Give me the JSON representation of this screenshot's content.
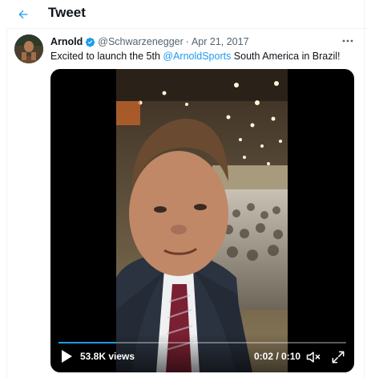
{
  "header": {
    "title": "Tweet",
    "back_icon": "arrow-left-icon"
  },
  "tweet": {
    "author_name": "Arnold",
    "handle": "@Schwarzenegger",
    "separator": "·",
    "date": "Apr 21, 2017",
    "text_before": "Excited to launch the 5th ",
    "mention": "@ArnoldSports",
    "text_after": " South America in Brazil!",
    "verified_icon": "verified-badge-icon",
    "more_icon": "more-horizontal-icon"
  },
  "video": {
    "views": "53.8K views",
    "time": "0:02 / 0:10",
    "progress": 0.2,
    "play_icon": "play-icon",
    "mute_icon": "volume-muted-icon",
    "fullscreen_icon": "fullscreen-icon"
  },
  "colors": {
    "accent": "#1d9bf0",
    "text": "#0f1419",
    "secondary": "#536471"
  }
}
